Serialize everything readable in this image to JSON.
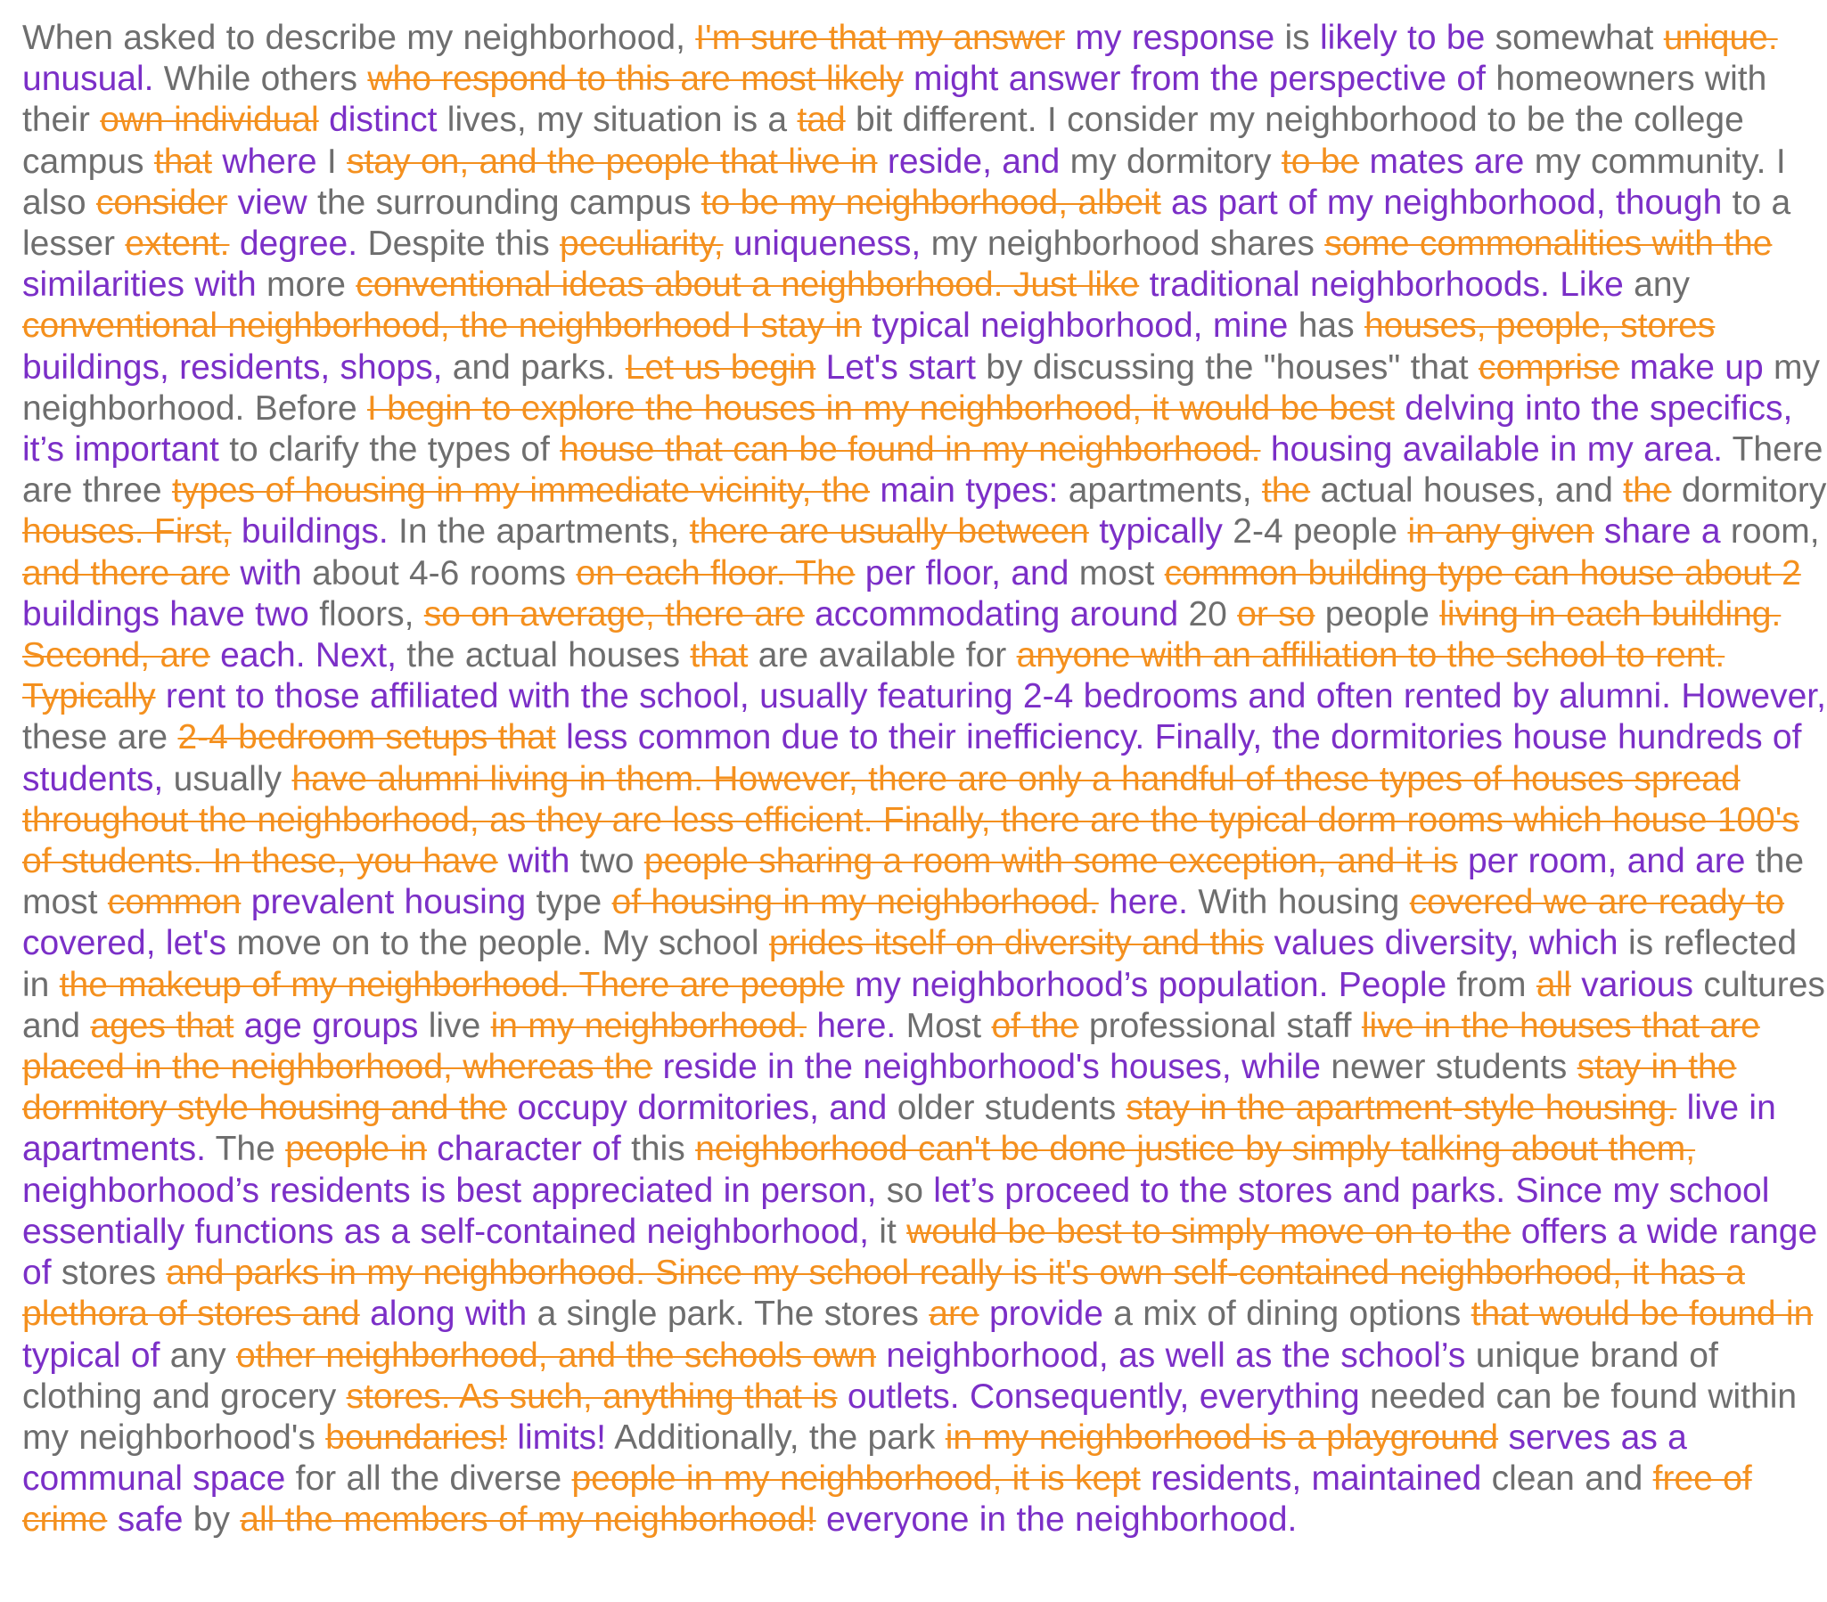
{
  "colors": {
    "kept": "#6e6e6e",
    "deleted": "#f4901e",
    "inserted": "#7b2fc7",
    "background": "#ffffff"
  },
  "segments": [
    {
      "t": "k",
      "s": "When asked to describe my neighborhood,"
    },
    {
      "t": "d",
      "s": "I'm sure that my answer"
    },
    {
      "t": "i",
      "s": "my response"
    },
    {
      "t": "k",
      "s": "is"
    },
    {
      "t": "i",
      "s": "likely to be"
    },
    {
      "t": "k",
      "s": "somewhat"
    },
    {
      "t": "d",
      "s": "unique."
    },
    {
      "t": "i",
      "s": "unusual."
    },
    {
      "t": "k",
      "s": "While others"
    },
    {
      "t": "d",
      "s": "who respond to this are most likely"
    },
    {
      "t": "i",
      "s": "might answer from the perspective of"
    },
    {
      "t": "k",
      "s": "homeowners with their"
    },
    {
      "t": "d",
      "s": "own individual"
    },
    {
      "t": "i",
      "s": "distinct"
    },
    {
      "t": "k",
      "s": "lives, my situation is a"
    },
    {
      "t": "d",
      "s": "tad"
    },
    {
      "t": "k",
      "s": "bit different. I consider my neighborhood to be the college campus"
    },
    {
      "t": "d",
      "s": "that"
    },
    {
      "t": "i",
      "s": "where"
    },
    {
      "t": "k",
      "s": "I"
    },
    {
      "t": "d",
      "s": "stay on, and the people that live in"
    },
    {
      "t": "i",
      "s": "reside, and"
    },
    {
      "t": "k",
      "s": "my dormitory"
    },
    {
      "t": "d",
      "s": "to be"
    },
    {
      "t": "i",
      "s": "mates are"
    },
    {
      "t": "k",
      "s": "my community. I also"
    },
    {
      "t": "d",
      "s": "consider"
    },
    {
      "t": "i",
      "s": "view"
    },
    {
      "t": "k",
      "s": "the surrounding campus"
    },
    {
      "t": "d",
      "s": "to be my neighborhood, albeit"
    },
    {
      "t": "i",
      "s": "as part of my neighborhood, though"
    },
    {
      "t": "k",
      "s": "to a lesser"
    },
    {
      "t": "d",
      "s": "extent."
    },
    {
      "t": "i",
      "s": "degree."
    },
    {
      "t": "k",
      "s": "Despite this"
    },
    {
      "t": "d",
      "s": "peculiarity,"
    },
    {
      "t": "i",
      "s": "uniqueness,"
    },
    {
      "t": "k",
      "s": "my neighborhood shares"
    },
    {
      "t": "d",
      "s": "some commonalities with the"
    },
    {
      "t": "i",
      "s": "similarities with"
    },
    {
      "t": "k",
      "s": "more"
    },
    {
      "t": "d",
      "s": "conventional ideas about a neighborhood. Just like"
    },
    {
      "t": "i",
      "s": "traditional neighborhoods. Like"
    },
    {
      "t": "k",
      "s": "any"
    },
    {
      "t": "d",
      "s": "conventional neighborhood, the neighborhood I stay in"
    },
    {
      "t": "i",
      "s": "typical neighborhood, mine"
    },
    {
      "t": "k",
      "s": "has"
    },
    {
      "t": "d",
      "s": "houses, people, stores"
    },
    {
      "t": "i",
      "s": "buildings, residents, shops,"
    },
    {
      "t": "k",
      "s": "and parks."
    },
    {
      "t": "d",
      "s": "Let us begin"
    },
    {
      "t": "i",
      "s": "Let's start"
    },
    {
      "t": "k",
      "s": "by discussing the \"houses\" that"
    },
    {
      "t": "d",
      "s": "comprise"
    },
    {
      "t": "i",
      "s": "make up"
    },
    {
      "t": "k",
      "s": "my neighborhood. Before"
    },
    {
      "t": "d",
      "s": "I begin to explore the houses in my neighborhood, it would be best"
    },
    {
      "t": "i",
      "s": "delving into the specifics, it’s important"
    },
    {
      "t": "k",
      "s": "to clarify the types of"
    },
    {
      "t": "d",
      "s": "house that can be found in my neighborhood."
    },
    {
      "t": "i",
      "s": "housing available in my area."
    },
    {
      "t": "k",
      "s": "There are three"
    },
    {
      "t": "d",
      "s": "types of housing in my immediate vicinity, the"
    },
    {
      "t": "i",
      "s": "main types:"
    },
    {
      "t": "k",
      "s": "apartments,"
    },
    {
      "t": "d",
      "s": "the"
    },
    {
      "t": "k",
      "s": "actual houses, and"
    },
    {
      "t": "d",
      "s": "the"
    },
    {
      "t": "k",
      "s": "dormitory"
    },
    {
      "t": "d",
      "s": "houses. First,"
    },
    {
      "t": "i",
      "s": "buildings."
    },
    {
      "t": "k",
      "s": "In the apartments,"
    },
    {
      "t": "d",
      "s": "there are usually between"
    },
    {
      "t": "i",
      "s": "typically"
    },
    {
      "t": "k",
      "s": "2-4 people"
    },
    {
      "t": "d",
      "s": "in any given"
    },
    {
      "t": "i",
      "s": "share a"
    },
    {
      "t": "k",
      "s": "room,"
    },
    {
      "t": "d",
      "s": "and there are"
    },
    {
      "t": "i",
      "s": "with"
    },
    {
      "t": "k",
      "s": "about 4-6 rooms"
    },
    {
      "t": "d",
      "s": "on each floor. The"
    },
    {
      "t": "i",
      "s": "per floor, and"
    },
    {
      "t": "k",
      "s": "most"
    },
    {
      "t": "d",
      "s": "common building type can house about 2"
    },
    {
      "t": "i",
      "s": "buildings have two"
    },
    {
      "t": "k",
      "s": "floors,"
    },
    {
      "t": "d",
      "s": "so on average, there are"
    },
    {
      "t": "i",
      "s": "accommodating around"
    },
    {
      "t": "k",
      "s": "20"
    },
    {
      "t": "d",
      "s": "or so"
    },
    {
      "t": "k",
      "s": "people"
    },
    {
      "t": "d",
      "s": "living in each building. Second, are"
    },
    {
      "t": "i",
      "s": "each. Next,"
    },
    {
      "t": "k",
      "s": "the actual houses"
    },
    {
      "t": "d",
      "s": "that"
    },
    {
      "t": "k",
      "s": "are available for"
    },
    {
      "t": "d",
      "s": "anyone with an affiliation to the school to rent. Typically"
    },
    {
      "t": "i",
      "s": "rent to those affiliated with the school, usually featuring 2-4 bedrooms and often rented by alumni. However,"
    },
    {
      "t": "k",
      "s": "these are"
    },
    {
      "t": "d",
      "s": "2-4 bedroom setups that"
    },
    {
      "t": "i",
      "s": "less common due to their inefficiency. Finally, the dormitories house hundreds of students,"
    },
    {
      "t": "k",
      "s": "usually"
    },
    {
      "t": "d",
      "s": "have alumni living in them. However, there are only a handful of these types of houses spread throughout the neighborhood, as they are less efficient. Finally, there are the typical dorm rooms which house 100's of students. In these, you have"
    },
    {
      "t": "i",
      "s": "with"
    },
    {
      "t": "k",
      "s": "two"
    },
    {
      "t": "d",
      "s": "people sharing a room with some exception, and it is"
    },
    {
      "t": "i",
      "s": "per room, and are"
    },
    {
      "t": "k",
      "s": "the most"
    },
    {
      "t": "d",
      "s": "common"
    },
    {
      "t": "i",
      "s": "prevalent housing"
    },
    {
      "t": "k",
      "s": "type"
    },
    {
      "t": "d",
      "s": "of housing in my neighborhood."
    },
    {
      "t": "i",
      "s": "here."
    },
    {
      "t": "k",
      "s": "With housing"
    },
    {
      "t": "d",
      "s": "covered we are ready to"
    },
    {
      "t": "i",
      "s": "covered, let's"
    },
    {
      "t": "k",
      "s": "move on to the people. My school"
    },
    {
      "t": "d",
      "s": "prides itself on diversity and this"
    },
    {
      "t": "i",
      "s": "values diversity, which"
    },
    {
      "t": "k",
      "s": "is reflected in"
    },
    {
      "t": "d",
      "s": "the makeup of my neighborhood. There are people"
    },
    {
      "t": "i",
      "s": "my neighborhood’s population. People"
    },
    {
      "t": "k",
      "s": "from"
    },
    {
      "t": "d",
      "s": "all"
    },
    {
      "t": "i",
      "s": "various"
    },
    {
      "t": "k",
      "s": "cultures and"
    },
    {
      "t": "d",
      "s": "ages that"
    },
    {
      "t": "i",
      "s": "age groups"
    },
    {
      "t": "k",
      "s": "live"
    },
    {
      "t": "d",
      "s": "in my neighborhood."
    },
    {
      "t": "i",
      "s": "here."
    },
    {
      "t": "k",
      "s": "Most"
    },
    {
      "t": "d",
      "s": "of the"
    },
    {
      "t": "k",
      "s": "professional staff"
    },
    {
      "t": "d",
      "s": "live in the houses that are placed in the neighborhood, whereas the"
    },
    {
      "t": "i",
      "s": "reside in the neighborhood's houses, while"
    },
    {
      "t": "k",
      "s": "newer students"
    },
    {
      "t": "d",
      "s": "stay in the dormitory style housing and the"
    },
    {
      "t": "i",
      "s": "occupy dormitories, and"
    },
    {
      "t": "k",
      "s": "older students"
    },
    {
      "t": "d",
      "s": "stay in the apartment-style housing."
    },
    {
      "t": "i",
      "s": "live in apartments."
    },
    {
      "t": "k",
      "s": "The"
    },
    {
      "t": "d",
      "s": "people in"
    },
    {
      "t": "i",
      "s": "character of"
    },
    {
      "t": "k",
      "s": "this"
    },
    {
      "t": "d",
      "s": "neighborhood can't be done justice by simply talking about them,"
    },
    {
      "t": "i",
      "s": "neighborhood’s residents is best appreciated in person,"
    },
    {
      "t": "k",
      "s": "so"
    },
    {
      "t": "i",
      "s": "let’s proceed to the stores and parks. Since my school essentially functions as a self-contained neighborhood,"
    },
    {
      "t": "k",
      "s": "it"
    },
    {
      "t": "d",
      "s": "would be best to simply move on to the"
    },
    {
      "t": "i",
      "s": "offers a wide range of"
    },
    {
      "t": "k",
      "s": "stores"
    },
    {
      "t": "d",
      "s": "and parks in my neighborhood. Since my school really is it's own self-contained neighborhood, it has a plethora of stores and"
    },
    {
      "t": "i",
      "s": "along with"
    },
    {
      "t": "k",
      "s": "a single park. The stores"
    },
    {
      "t": "d",
      "s": "are"
    },
    {
      "t": "i",
      "s": "provide"
    },
    {
      "t": "k",
      "s": "a mix of dining options"
    },
    {
      "t": "d",
      "s": "that would be found in"
    },
    {
      "t": "i",
      "s": "typical of"
    },
    {
      "t": "k",
      "s": "any"
    },
    {
      "t": "d",
      "s": "other neighborhood, and the schools own"
    },
    {
      "t": "i",
      "s": "neighborhood, as well as the school’s"
    },
    {
      "t": "k",
      "s": "unique brand of clothing and grocery"
    },
    {
      "t": "d",
      "s": "stores. As such, anything that is"
    },
    {
      "t": "i",
      "s": "outlets. Consequently, everything"
    },
    {
      "t": "k",
      "s": "needed can be found within my neighborhood's"
    },
    {
      "t": "d",
      "s": "boundaries!"
    },
    {
      "t": "i",
      "s": "limits!"
    },
    {
      "t": "k",
      "s": "Additionally, the park"
    },
    {
      "t": "d",
      "s": "in my neighborhood is a playground"
    },
    {
      "t": "i",
      "s": "serves as a communal space"
    },
    {
      "t": "k",
      "s": "for all the diverse"
    },
    {
      "t": "d",
      "s": "people in my neighborhood, it is kept"
    },
    {
      "t": "i",
      "s": "residents, maintained"
    },
    {
      "t": "k",
      "s": "clean and"
    },
    {
      "t": "d",
      "s": "free of crime"
    },
    {
      "t": "i",
      "s": "safe"
    },
    {
      "t": "k",
      "s": "by"
    },
    {
      "t": "d",
      "s": "all the members of my neighborhood!"
    },
    {
      "t": "i",
      "s": "everyone in the neighborhood."
    }
  ]
}
